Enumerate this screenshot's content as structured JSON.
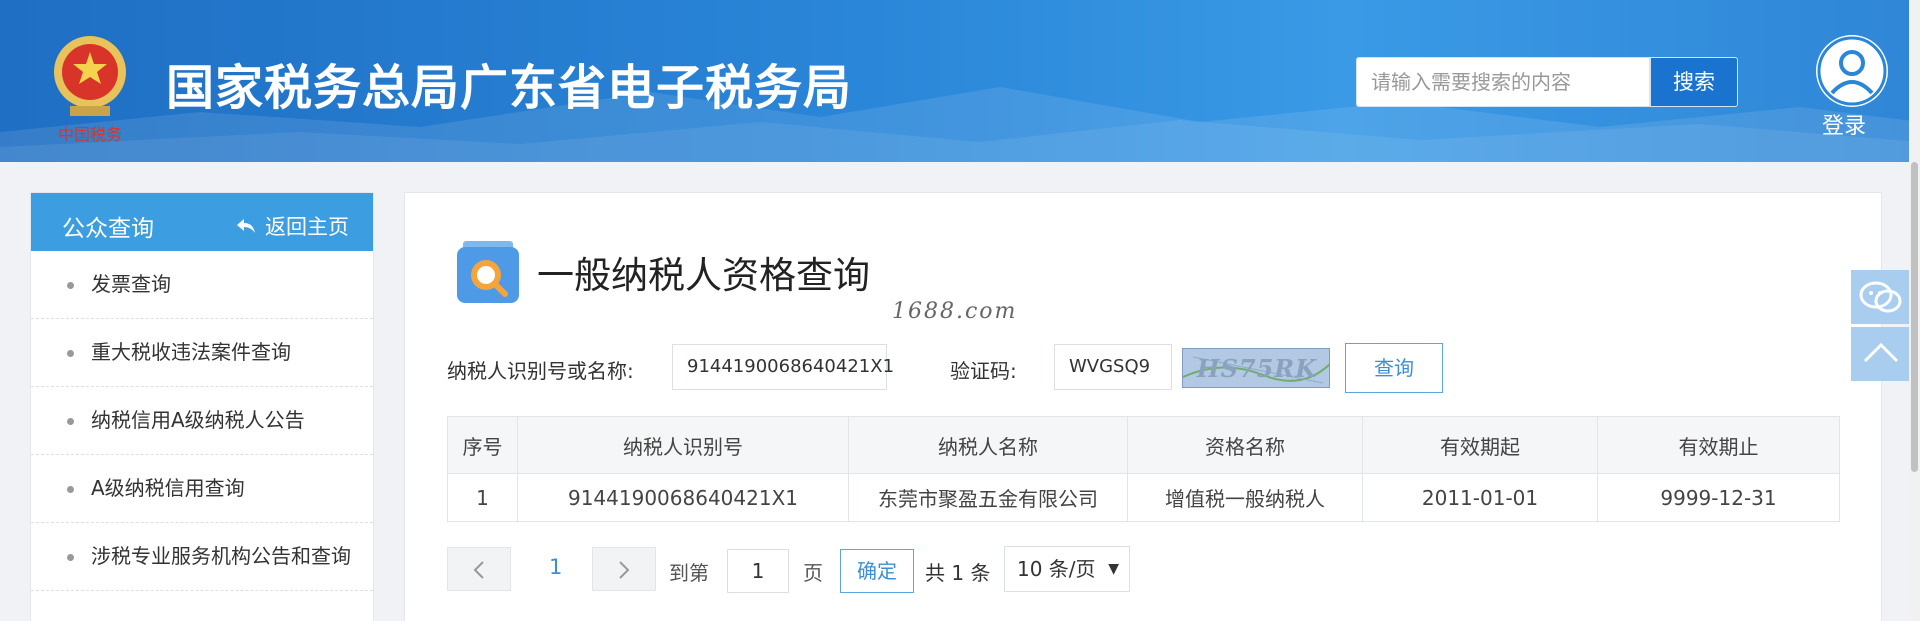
{
  "header": {
    "emblem_caption": "中国税务",
    "site_title": "国家税务总局广东省电子税务局",
    "search_placeholder": "请输入需要搜索的内容",
    "search_button": "搜索",
    "login_label": "登录"
  },
  "sidebar": {
    "title": "公众查询",
    "back_label": "返回主页",
    "items": [
      {
        "label": "发票查询"
      },
      {
        "label": "重大税收违法案件查询"
      },
      {
        "label": "纳税信用A级纳税人公告"
      },
      {
        "label": "A级纳税信用查询"
      },
      {
        "label": "涉税专业服务机构公告和查询"
      },
      {
        "label": ""
      }
    ]
  },
  "main": {
    "page_title": "一般纳税人资格查询",
    "watermark": "1688.com",
    "form": {
      "taxpayer_label": "纳税人识别号或名称:",
      "taxpayer_value": "9144190068640421X1",
      "captcha_label": "验证码:",
      "captcha_value": "WVGSQ9",
      "captcha_image_text": "HS75RK",
      "query_button": "查询"
    },
    "table": {
      "headers": [
        "序号",
        "纳税人识别号",
        "纳税人名称",
        "资格名称",
        "有效期起",
        "有效期止"
      ],
      "rows": [
        [
          "1",
          "9144190068640421X1",
          "东莞市聚盈五金有限公司",
          "增值税一般纳税人",
          "2011-01-01",
          "9999-12-31"
        ]
      ]
    },
    "pager": {
      "current_page": "1",
      "goto_label": "到第",
      "goto_value": "1",
      "page_suffix": "页",
      "confirm_button": "确定",
      "total_text": "共 1 条",
      "page_size": "10 条/页"
    }
  },
  "colors": {
    "header_blue": "#2a86d8",
    "accent_blue": "#3c9de0",
    "link_blue": "#3c8fd6"
  },
  "icons": [
    "national-emblem-icon",
    "user-avatar-icon",
    "back-arrow-icon",
    "search-doc-icon",
    "wechat-icon",
    "back-to-top-icon",
    "prev-page-icon",
    "next-page-icon",
    "chevron-down-icon"
  ]
}
